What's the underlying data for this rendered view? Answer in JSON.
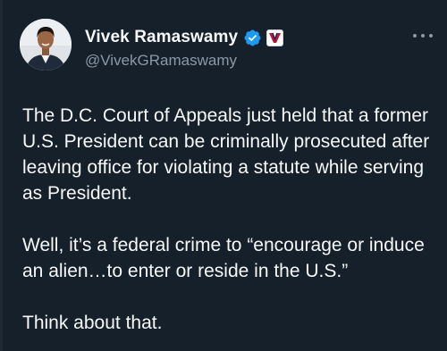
{
  "author": {
    "display_name": "Vivek Ramaswamy",
    "handle": "@VivekGRamaswamy",
    "verified_icon": "verified-check-icon",
    "affiliate_icon": "campaign-v-logo-icon",
    "verified_color": "#1d9bf0"
  },
  "menu": {
    "icon": "more-horizontal-icon"
  },
  "tweet": {
    "paragraphs": [
      "The D.C. Court of Appeals just held that a former U.S. President can be criminally prosecuted after leaving office for violating a statute while serving as President.",
      "Well, it’s a federal crime to “encourage or induce an alien…to enter or reside in the U.S.”",
      "Think about that."
    ]
  },
  "colors": {
    "background": "#15202b",
    "text": "#f7f9f9",
    "secondary_text": "#8b98a5"
  }
}
